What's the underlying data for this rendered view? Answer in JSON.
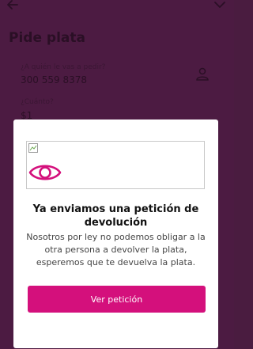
{
  "header": {
    "title": "Pide plata"
  },
  "form": {
    "recipient_label": "¿A quién le vas a pedir?",
    "recipient_value": "300 559 8378",
    "amount_label": "¿Cuánto?",
    "amount_value": "$1"
  },
  "icons": {
    "back": "arrow-left",
    "dropdown": "chevron-down",
    "contacts": "person",
    "modal_image": "eye",
    "broken_image": "broken-image"
  },
  "colors": {
    "accent": "#d4107c",
    "overlay": "#4c1b42",
    "modal_background": "#ffffff"
  },
  "modal": {
    "title": "Ya enviamos una petición de devolución",
    "body": "Nosotros por ley no podemos obligar a la otra persona a devolver la plata, esperemos que te devuelva la plata.",
    "button_label": "Ver petición"
  }
}
